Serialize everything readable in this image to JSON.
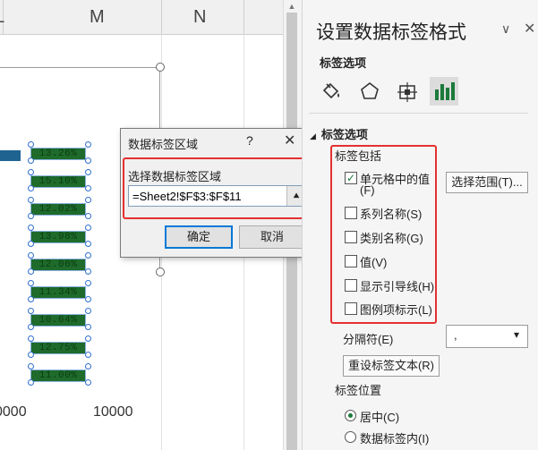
{
  "sheet": {
    "columns": [
      "L",
      "M",
      "N"
    ],
    "axis_ticks": [
      "0000",
      "10000"
    ],
    "label_chips": [
      "13.26%",
      "15.10%",
      "12.02%",
      "13.98%",
      "12.06%",
      "11.34%",
      "10.64%",
      "12.75%",
      "11.00%"
    ]
  },
  "dialog": {
    "title": "数据标签区域",
    "help": "?",
    "close": "✕",
    "field_label": "选择数据标签区域",
    "range_value": "=Sheet2!$F$3:$F$11",
    "collapse_icon": "⯅",
    "ok_label": "确定",
    "cancel_label": "取消",
    "highlight_color": "#e53030"
  },
  "pane": {
    "title": "设置数据标签格式",
    "chevron": "∨",
    "close": "✕",
    "subtitle": "标签选项",
    "tabs": [
      "fill-icon",
      "pentagon-icon",
      "size-icon",
      "bar-chart-icon"
    ],
    "section": "标签选项",
    "section_chevron": "◢",
    "group_label": "标签包括",
    "options": [
      {
        "label": "单元格中的值",
        "key": "(F)",
        "checked": true
      },
      {
        "label": "系列名称(S)",
        "checked": false
      },
      {
        "label": "类别名称(G)",
        "checked": false
      },
      {
        "label": "值(V)",
        "checked": false
      },
      {
        "label": "显示引导线(H)",
        "checked": false
      },
      {
        "label": "图例项标示(L)",
        "checked": false
      }
    ],
    "range_button": "选择范围(T)...",
    "separator_label": "分隔符(E)",
    "separator_value": ",",
    "separator_arrow": "▾",
    "reset_button": "重设标签文本(R)",
    "position_label": "标签位置",
    "positions": [
      {
        "label": "居中(C)",
        "selected": true
      },
      {
        "label": "数据标签内(I)",
        "selected": false
      }
    ],
    "accent_color": "#1b7a3b"
  }
}
